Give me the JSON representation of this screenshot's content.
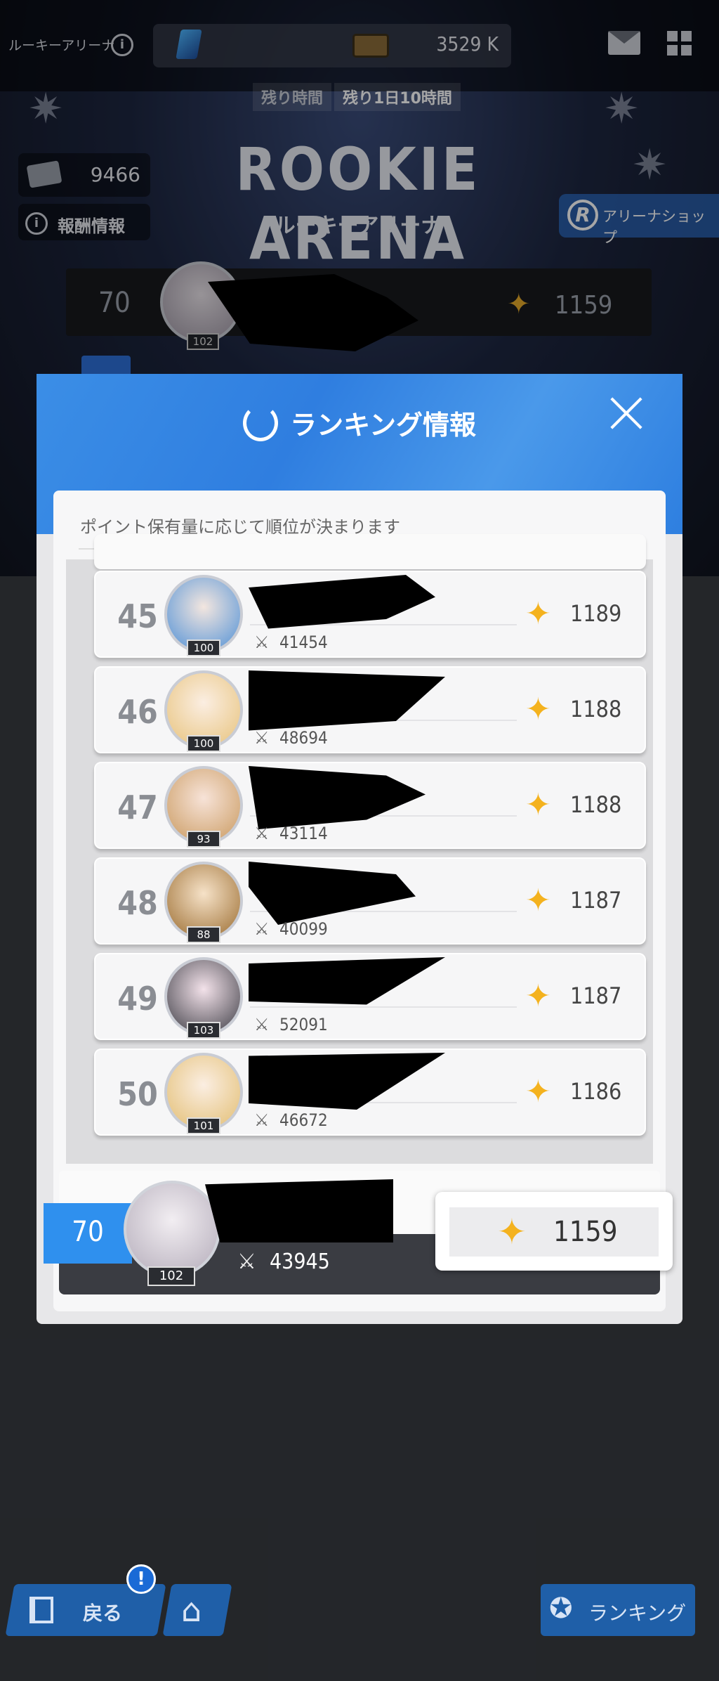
{
  "topbar": {
    "arena_label": "ルーキーアリーナ",
    "currency_value": "3529 K"
  },
  "timer": {
    "label": "残り時間",
    "value": "残り1日10時間"
  },
  "arena": {
    "title": "ROOKIE ARENA",
    "subtitle": "ルーキーアリーナ",
    "ticket_count": "9466",
    "reward_label": "報酬情報",
    "shop_label": "アリーナショップ"
  },
  "background_my_row": {
    "rank": "70",
    "level": "102",
    "points": "1159"
  },
  "modal": {
    "title": "ランキング情報",
    "description": "ポイント保有量に応じて順位が決まります",
    "rows": [
      {
        "rank": "45",
        "level": "100",
        "power": "41454",
        "points": "1189"
      },
      {
        "rank": "46",
        "level": "100",
        "power": "48694",
        "points": "1188"
      },
      {
        "rank": "47",
        "level": "93",
        "power": "43114",
        "points": "1188"
      },
      {
        "rank": "48",
        "level": "88",
        "power": "40099",
        "points": "1187"
      },
      {
        "rank": "49",
        "level": "103",
        "power": "52091",
        "points": "1187"
      },
      {
        "rank": "50",
        "level": "101",
        "power": "46672",
        "points": "1186"
      }
    ],
    "me": {
      "rank": "70",
      "level": "102",
      "power": "43945",
      "points": "1159"
    }
  },
  "bottom": {
    "back_label": "戻る",
    "notification": "!",
    "ranking_label": "ランキング"
  },
  "colors": {
    "accent_blue": "#2f90ee",
    "star_gold": "#f4b21e"
  }
}
